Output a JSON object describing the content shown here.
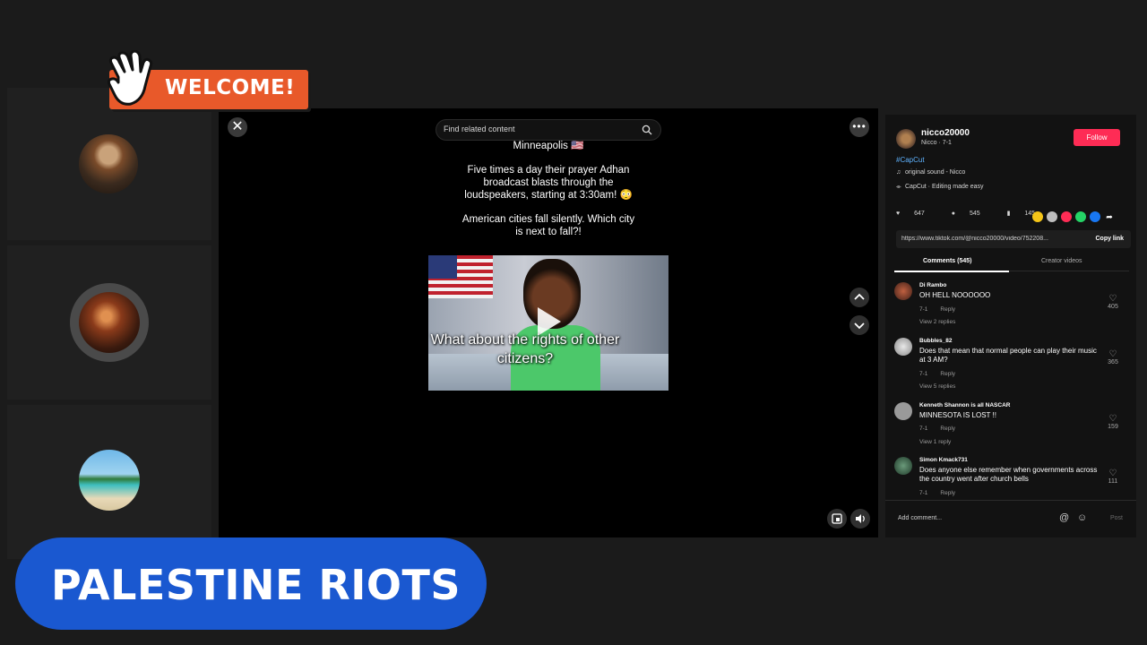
{
  "overlay": {
    "welcome_label": "WELCOME!",
    "lower_third_title": "PALESTINE RIOTS"
  },
  "video": {
    "search_placeholder": "Find related content",
    "caption": {
      "line1": "Minneapolis 🇺🇸",
      "line2": "Five times a day their prayer Adhan broadcast blasts through the loudspeakers, starting at 3:30am! 😳",
      "line3": "American cities fall silently. Which city is next to fall?!"
    },
    "thumbnail_text": "What about the rights of other citizens?"
  },
  "panel": {
    "username": "nicco20000",
    "subline": "Nicco · 7-1",
    "follow_label": "Follow",
    "hashtag": "#CapCut",
    "sound": "original sound - Nicco",
    "capcut": "CapCut · Editing made easy",
    "likes": "647",
    "comments_count": "545",
    "saves": "145",
    "link": "https://www.tiktok.com/@nicco20000/video/752208...",
    "copy_link_label": "Copy link",
    "tab_comments": "Comments (545)",
    "tab_creator": "Creator videos",
    "comments": [
      {
        "name": "Di Rambo",
        "text": "OH HELL NOOOOOO",
        "date": "7-1",
        "reply": "Reply",
        "likes": "405",
        "replies": "View 2 replies"
      },
      {
        "name": "Bubbles_82",
        "text": "Does that mean that normal people can play their music at 3 AM?",
        "date": "7-1",
        "reply": "Reply",
        "likes": "365",
        "replies": "View 5 replies"
      },
      {
        "name": "Kenneth Shannon is all NASCAR",
        "text": "MINNESOTA IS LOST !!",
        "date": "7-1",
        "reply": "Reply",
        "likes": "159",
        "replies": "View 1 reply"
      },
      {
        "name": "Simon Kmack731",
        "text": "Does anyone else remember when governments across the country went after church bells",
        "date": "7-1",
        "reply": "Reply",
        "likes": "111",
        "replies": ""
      }
    ],
    "add_comment_placeholder": "Add comment...",
    "post_label": "Post"
  },
  "colors": {
    "accent_follow": "#fe2c55",
    "lower_third": "#1a58d0",
    "welcome_badge": "#e8592a",
    "hashtag": "#5fb3ff"
  }
}
